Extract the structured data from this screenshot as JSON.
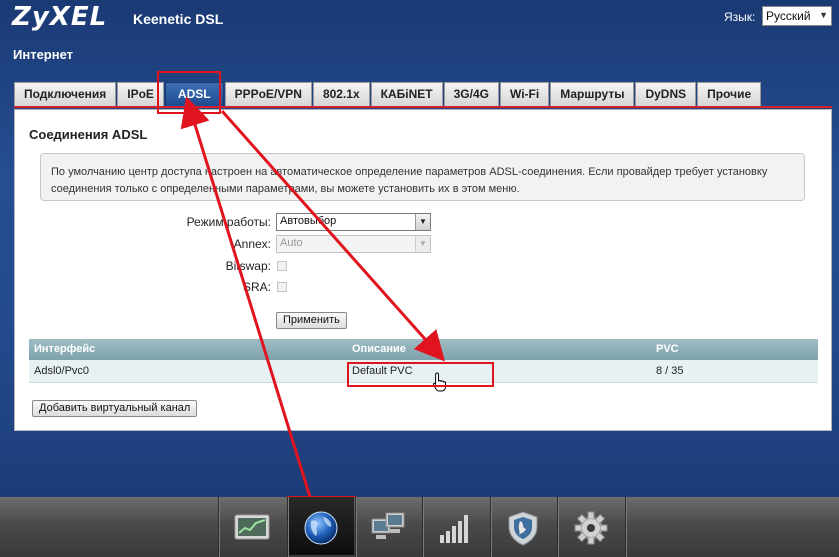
{
  "brand": {
    "logo": "ZyXEL",
    "product": "Keenetic DSL"
  },
  "language": {
    "label": "Язык:",
    "selected": "Русский"
  },
  "page": {
    "title": "Интернет"
  },
  "tabs": [
    {
      "label": "Подключения"
    },
    {
      "label": "IPoE"
    },
    {
      "label": "ADSL"
    },
    {
      "label": "PPPoE/VPN"
    },
    {
      "label": "802.1x"
    },
    {
      "label": "КАБiNET"
    },
    {
      "label": "3G/4G"
    },
    {
      "label": "Wi-Fi"
    },
    {
      "label": "Маршруты"
    },
    {
      "label": "DyDNS"
    },
    {
      "label": "Прочие"
    }
  ],
  "active_tab": "ADSL",
  "section": {
    "title": "Соединения ADSL",
    "info_line1": "По умолчанию центр доступа настроен на автоматическое определение параметров ADSL-соединения. Если провайдер требует установку",
    "info_line2": "соединения только с определенными параметрами, вы можете установить их в этом меню."
  },
  "form": {
    "mode_label": "Режим работы:",
    "mode_value": "Автовыбор",
    "annex_label": "Annex:",
    "annex_value": "Auto",
    "bitswap_label": "Bitswap:",
    "sra_label": "SRA:",
    "apply_label": "Применить"
  },
  "table": {
    "headers": [
      "Интерфейс",
      "Описание",
      "PVC"
    ],
    "rows": [
      {
        "interface": "Adsl0/Pvc0",
        "description": "Default PVC",
        "pvc": "8 / 35"
      }
    ]
  },
  "add_channel_label": "Добавить виртуальный канал",
  "bottom_bar": {
    "icons": [
      "monitor-chart-icon",
      "globe-icon",
      "network-computers-icon",
      "signal-bars-icon",
      "shield-icon",
      "gear-icon"
    ],
    "active_icon": "globe-icon"
  },
  "colors": {
    "header_blue": "#23498c",
    "tab_active": "#1d4b92",
    "annotation_red": "#e0141e",
    "table_header": "#8aadb6",
    "table_row": "#e7f0f2"
  }
}
